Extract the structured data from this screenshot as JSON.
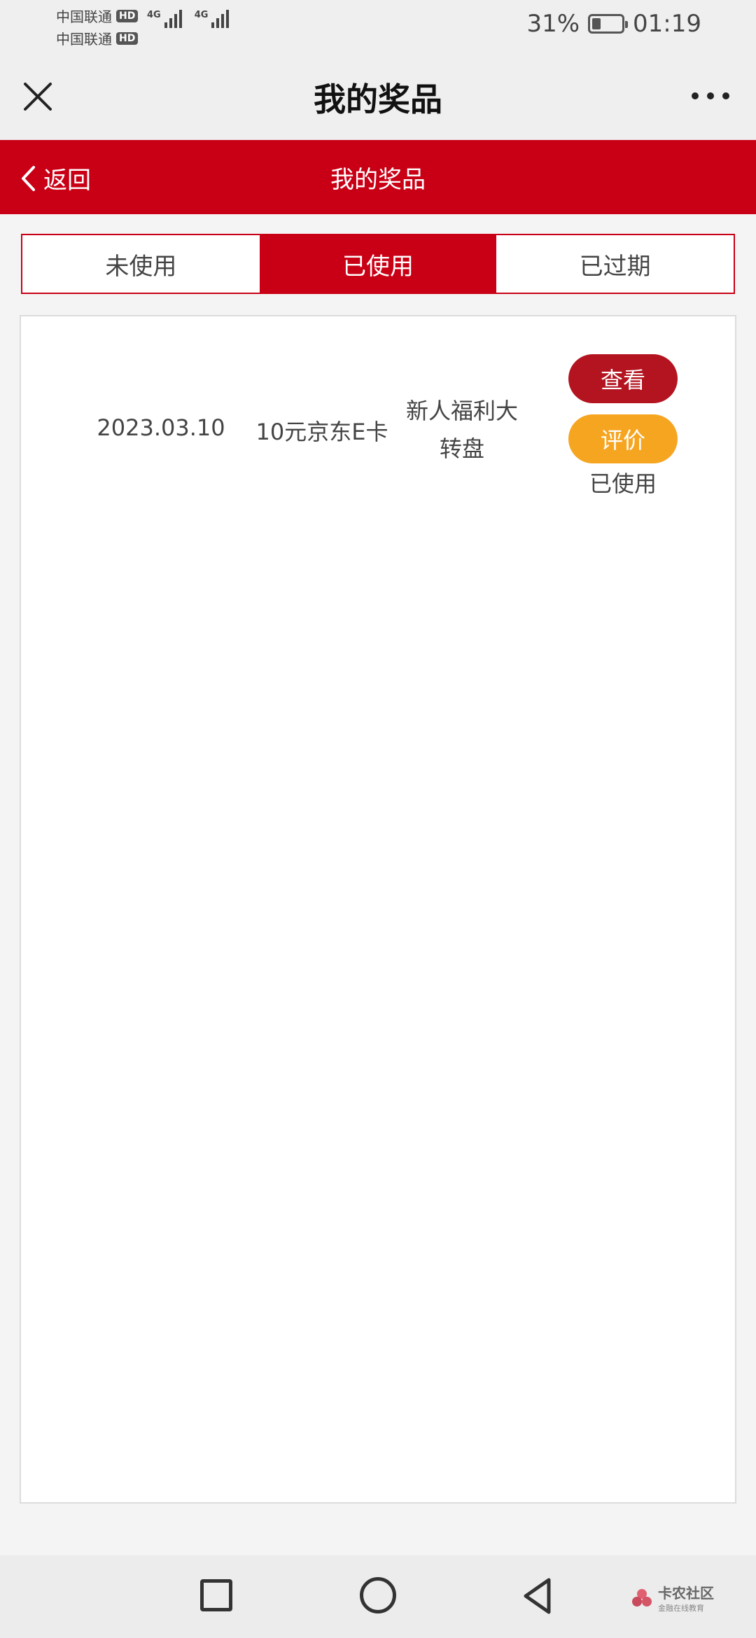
{
  "status_bar": {
    "carrier_1": "中国联通",
    "carrier_2": "中国联通",
    "hd_badge": "HD",
    "network_1": "4G",
    "network_2": "4G",
    "battery_percent": "31%",
    "battery_level": 0.31,
    "time": "01:19"
  },
  "title_bar": {
    "title": "我的奖品",
    "close_icon": "close-icon",
    "more_icon": "more-dots-icon"
  },
  "header": {
    "back_label": "返回",
    "title": "我的奖品",
    "background_color": "#c90015"
  },
  "tabs": [
    {
      "label": "未使用",
      "active": false
    },
    {
      "label": "已使用",
      "active": true
    },
    {
      "label": "已过期",
      "active": false
    }
  ],
  "prizes": [
    {
      "date": "2023.03.10",
      "prize": "10元京东E卡",
      "source_line1": "新人福利大",
      "source_line2": "转盘",
      "view_button": "查看",
      "review_button": "评价",
      "status": "已使用"
    }
  ],
  "nav": {
    "recent_icon": "square-icon",
    "home_icon": "circle-icon",
    "back_icon": "triangle-back-icon"
  },
  "watermark": {
    "main": "卡农社区",
    "sub": "金融在线教育"
  },
  "colors": {
    "accent_red": "#c90015",
    "view_button": "#b3141f",
    "review_button": "#f6a520"
  }
}
